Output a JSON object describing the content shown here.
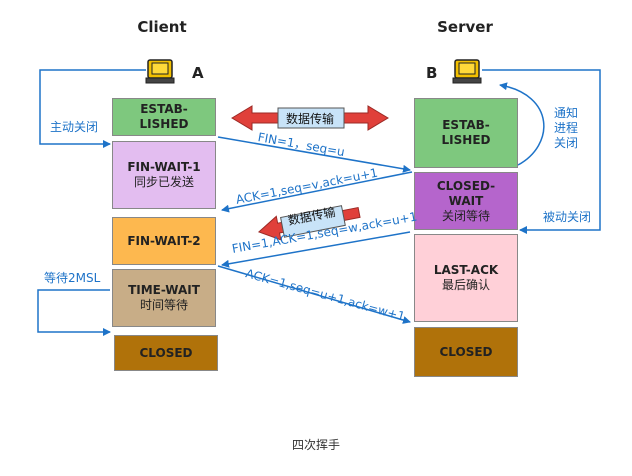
{
  "headers": {
    "client": "Client",
    "server": "Server"
  },
  "nodes": {
    "a": "A",
    "b": "B"
  },
  "client_states": [
    {
      "title": "ESTAB-",
      "title2": "LISHED",
      "sub": "",
      "color": "#7ec87e"
    },
    {
      "title": "FIN-WAIT-1",
      "title2": "",
      "sub": "同步已发送",
      "color": "#e3bdf0"
    },
    {
      "title": "FIN-WAIT-2",
      "title2": "",
      "sub": "",
      "color": "#fdb84f"
    },
    {
      "title": "TIME-WAIT",
      "title2": "",
      "sub": "时间等待",
      "color": "#c8ad87"
    },
    {
      "title": "CLOSED",
      "title2": "",
      "sub": "",
      "color": "#b0720a"
    }
  ],
  "server_states": [
    {
      "title": "ESTAB-",
      "title2": "LISHED",
      "sub": "",
      "color": "#7ec87e"
    },
    {
      "title": "CLOSED-",
      "title2": "WAIT",
      "sub": "关闭等待",
      "color": "#b565cc"
    },
    {
      "title": "LAST-ACK",
      "title2": "",
      "sub": "最后确认",
      "color": "#ffd0d8"
    },
    {
      "title": "CLOSED",
      "title2": "",
      "sub": "",
      "color": "#b0720a"
    }
  ],
  "messages": [
    "FIN=1，seq=u",
    "ACK=1,seq=v,ack=u+1",
    "FIN=1,ACK=1,seq=w,ack=u+1",
    "ACK=1,seq=u+1,ack=w+1"
  ],
  "data_transfer": "数据传输",
  "side_labels": {
    "active_close": "主动关闭",
    "notify_process": "通知进程关闭",
    "passive_close": "被动关闭",
    "wait_2msl": "等待2MSL"
  },
  "caption": "四次挥手",
  "colors": {
    "line": "#1e73c8",
    "arrow_red": "#e0403a",
    "data_fill": "#c8e3f8"
  }
}
